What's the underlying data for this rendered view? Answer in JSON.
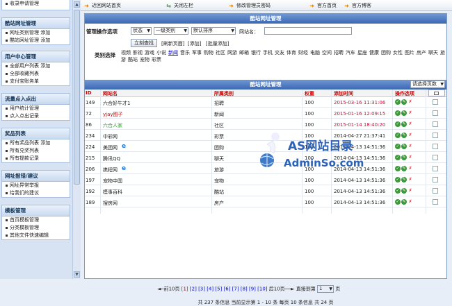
{
  "sidebar": {
    "top_item": "收录申请管理",
    "groups": [
      {
        "title": "酷站网址管理",
        "items": [
          "网址类别管理 添加",
          "酷站网址管理 添加"
        ]
      },
      {
        "title": "用户中心管理",
        "items": [
          "全部用户列表 添加",
          "全部收藏列表",
          "支付宝账务单"
        ]
      },
      {
        "title": "流量点入点出",
        "items": [
          "用户统计管理",
          "点入点出记录"
        ]
      },
      {
        "title": "奖品列表",
        "items": [
          "所有奖品列表 添加",
          "所有兑奖列表",
          "所有提款记录"
        ]
      },
      {
        "title": "网址报错/建议",
        "items": [
          "网址异常举报",
          "给我们的建议"
        ]
      },
      {
        "title": "模板管理",
        "items": [
          "首页模板管理",
          "分类模板管理",
          "其他文件快速编辑"
        ]
      }
    ]
  },
  "topnav": {
    "links": [
      "近回网站首页",
      "关闭左栏",
      "修改管理员密码",
      "官方首页",
      "官方博客"
    ]
  },
  "panel": {
    "title": "酷站网址管理",
    "ops_label": "管理操作选项",
    "selects": {
      "status": "状态",
      "category": "一级类别",
      "sort": "默认排序"
    },
    "site_name_label": "网站名：",
    "site_name_value": "",
    "search_button": "立刻查找",
    "refresh_link": "[刷新页面]",
    "add_link": "[添加]",
    "batch_add_link": "[批量添加]",
    "cat_label": "类别选择",
    "categories": [
      "视频",
      "影视",
      "游戏",
      "小说",
      "新闻",
      "音乐",
      "军事",
      "购物",
      "社区",
      "网游",
      "邮箱",
      "银行",
      "手机",
      "交友",
      "体育",
      "财经",
      "电脑",
      "空间",
      "招聘",
      "汽车",
      "星座",
      "健康",
      "团购",
      "女性",
      "图片",
      "房产",
      "聊天",
      "旅游",
      "酷站",
      "宠物",
      "彩票"
    ],
    "current_category": "新闻"
  },
  "list": {
    "title": "酷站网址管理",
    "per_page_select": "请选择页数",
    "headers": {
      "id": "ID",
      "name": "网站名",
      "category": "所属类别",
      "weight": "权重",
      "time": "添加时间",
      "ops": "操作选项"
    },
    "rows": [
      {
        "id": "149",
        "name": "六合好牛才1",
        "category": "招聘",
        "weight": "100",
        "time": "2015-03-16 11:31:06",
        "hot": true,
        "name_color": "#222"
      },
      {
        "id": "72",
        "name": "yjay图子",
        "category": "新闻",
        "weight": "100",
        "time": "2015-01-16 12:09:15",
        "hot": true,
        "name_color": "#c00"
      },
      {
        "id": "86",
        "name": "六合人家",
        "category": "社区",
        "weight": "100",
        "time": "2015-01-14 18:40:20",
        "hot": true,
        "name_color": "#2a2"
      },
      {
        "id": "234",
        "name": "中彩网",
        "category": "彩票",
        "weight": "100",
        "time": "2014-04-27 21:37:41",
        "hot": false,
        "name_color": "#222"
      },
      {
        "id": "224",
        "name": "美团网",
        "category": "团购",
        "weight": "100",
        "time": "2014-04-13 14:51:36",
        "hot": false,
        "name_color": "#222",
        "ie": true
      },
      {
        "id": "215",
        "name": "腾讯QQ",
        "category": "聊天",
        "weight": "100",
        "time": "2014-04-13 14:51:36",
        "hot": false,
        "name_color": "#222"
      },
      {
        "id": "206",
        "name": "携程网",
        "category": "旅游",
        "weight": "100",
        "time": "2014-04-13 14:51:36",
        "hot": false,
        "name_color": "#222",
        "ie": true
      },
      {
        "id": "197",
        "name": "宠物中国",
        "category": "宠物",
        "weight": "100",
        "time": "2014-04-13 14:51:36",
        "hot": false,
        "name_color": "#222"
      },
      {
        "id": "192",
        "name": "模事百科",
        "category": "酷站",
        "weight": "100",
        "time": "2014-04-13 14:51:36",
        "hot": false,
        "name_color": "#222"
      },
      {
        "id": "189",
        "name": "搜房网",
        "category": "房产",
        "weight": "100",
        "time": "2014-04-13 14:51:36",
        "hot": false,
        "name_color": "#222"
      }
    ],
    "pager": {
      "prev": "◄─前10页",
      "current": "[1]",
      "pages": [
        "[2]",
        "[3]",
        "[4]",
        "[5]",
        "[6]",
        "[7]",
        "[8]",
        "[9]",
        "[10]"
      ],
      "next": "后10页──►",
      "jump_label": "直接到第",
      "jump_value": "1",
      "jump_unit": "页"
    },
    "summary": "共 237 条信息 当前显示第 1 - 10 条 每页 10 条信息 共 24 页"
  },
  "watermark": {
    "line1": "AS网站目录",
    "line2": "AdminSo.com"
  },
  "colors": {
    "accent": "#3b68b4",
    "time_red": "#e0003c",
    "label_red": "#c00"
  }
}
